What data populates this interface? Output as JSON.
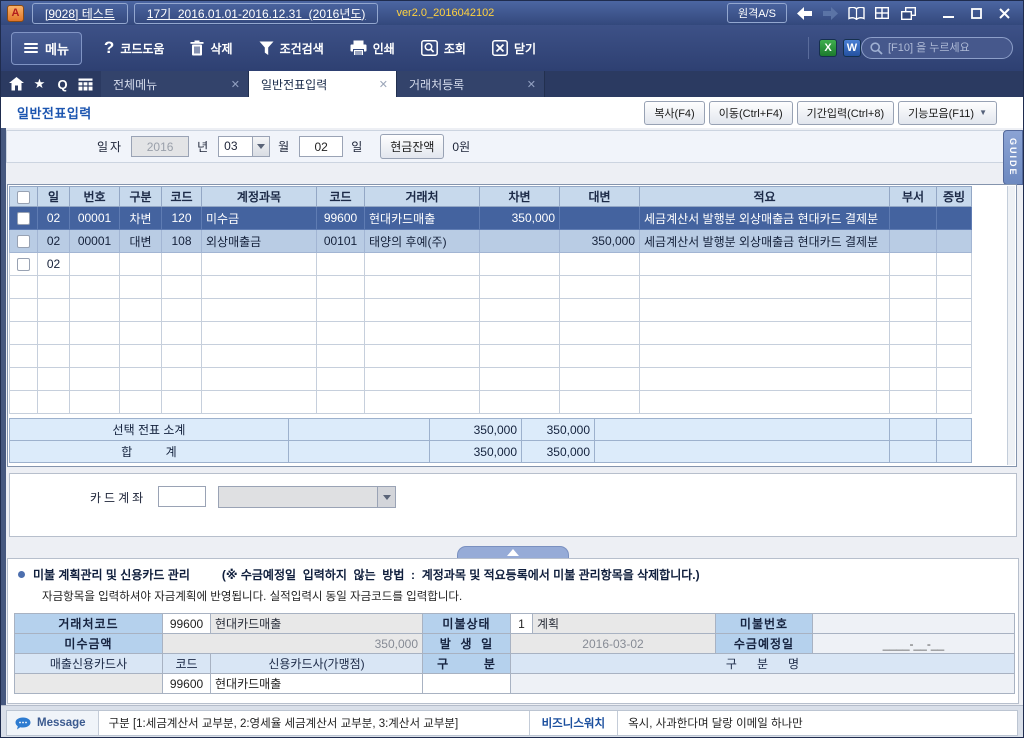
{
  "titlebar": {
    "company": "[9028] 테스트",
    "period": "17기  2016.01.01-2016.12.31  (2016년도)",
    "version": "ver2.0_2016042102",
    "remote": "원격A/S"
  },
  "toolbar": {
    "menu": "메뉴",
    "code_help": "코드도움",
    "delete": "삭제",
    "filter": "조건검색",
    "print": "인쇄",
    "inquiry": "조회",
    "close": "닫기",
    "search_placeholder": "[F10] 을 누르세요"
  },
  "tabs": {
    "t1": "전체메뉴",
    "t2": "일반전표입력",
    "t3": "거래처등록"
  },
  "page": {
    "title": "일반전표입력",
    "btn_copy": "복사(F4)",
    "btn_move": "이동(Ctrl+F4)",
    "btn_period": "기간입력(Ctrl+8)",
    "btn_func": "기능모음(F11)",
    "guide": "GUIDE"
  },
  "daterow": {
    "lbl_date": "일자",
    "year": "2016",
    "lbl_year": "년",
    "month": "03",
    "lbl_month": "월",
    "day": "02",
    "lbl_day": "일",
    "btn_cash": "현금잔액",
    "cash": "0원"
  },
  "grid": {
    "headers": {
      "day": "일",
      "no": "번호",
      "type": "구분",
      "code1": "코드",
      "account": "계정과목",
      "code2": "코드",
      "customer": "거래처",
      "debit": "차변",
      "credit": "대변",
      "desc": "적요",
      "dept": "부서",
      "doc": "증빙"
    },
    "rows": [
      {
        "day": "02",
        "no": "00001",
        "type": "차변",
        "code1": "120",
        "account": "미수금",
        "code2": "99600",
        "customer": "현대카드매출",
        "debit": "350,000",
        "credit": "",
        "desc": "세금계산서 발행분 외상매출금 현대카드 결제분"
      },
      {
        "day": "02",
        "no": "00001",
        "type": "대변",
        "code1": "108",
        "account": "외상매출금",
        "code2": "00101",
        "customer": "태양의 후예(주)",
        "debit": "",
        "credit": "350,000",
        "desc": "세금계산서 발행분 외상매출금 현대카드 결제분"
      },
      {
        "day": "02"
      }
    ],
    "subtotal": {
      "label": "선택 전표 소계",
      "debit": "350,000",
      "credit": "350,000"
    },
    "total": {
      "label": "합          계",
      "debit": "350,000",
      "credit": "350,000"
    }
  },
  "card": {
    "label": "카드계좌"
  },
  "lower": {
    "title": "미불 계획관리 및 신용카드 관리",
    "note": "(※ 수금예정일  입력하지  않는  방법  :  계정과목 및 적요등록에서 미불 관리항목을 삭제합니다.)",
    "subtitle": "자금항목을 입력하셔야 자금계획에 반영됩니다. 실적입력시 동일 자금코드를 입력합니다.",
    "f": {
      "cust_label": "거래처코드",
      "cust_code": "99600",
      "cust_name": "현대카드매출",
      "status_label": "미불상태",
      "status_code": "1",
      "status_name": "계획",
      "billno_label": "미불번호",
      "amt_label": "미수금액",
      "amount": "350,000",
      "occur_label": "발  생  일",
      "occur": "2016-03-02",
      "due_label": "수금예정일",
      "due": "____-__-__",
      "cardco_label": "매출신용카드사",
      "code_hdr": "코드",
      "cardco_hdr": "신용카드사(가맹점)",
      "gubun_label": "구        분",
      "gubunname_hdr": "구      분      명",
      "card_code": "99600",
      "card_name": "현대카드매출"
    }
  },
  "statusbar": {
    "msg_label": "Message",
    "message": "구분 [1:세금계산서 교부분, 2:영세율 세금계산서 교부분, 3:계산서 교부분]",
    "news_label": "비즈니스워치",
    "news": "옥시, 사과한다며 달랑 이메일 하나만"
  },
  "colors": {
    "titlebar": "#3d5590",
    "toolbar": "#35497d",
    "selected_row": "#44639f",
    "grid_header": "#c7d9ec",
    "label_cell": "#b5d1ed",
    "version_text": "#ffd23f",
    "accent": "#1c55b0"
  }
}
